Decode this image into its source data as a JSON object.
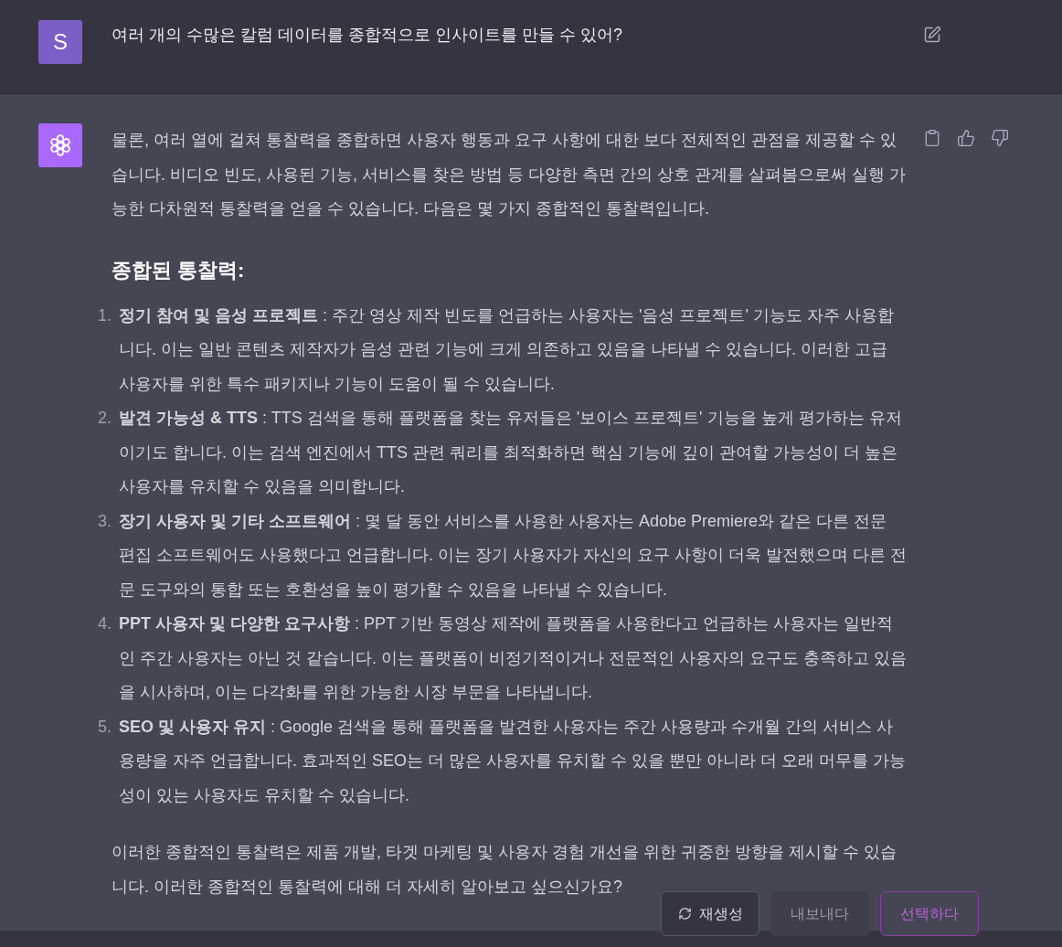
{
  "user_message": {
    "avatar_letter": "S",
    "text": "여러 개의 수많은 칼럼 데이터를 종합적으로 인사이트를 만들 수 있어?"
  },
  "assistant_message": {
    "intro": "물론, 여러 열에 걸쳐 통찰력을 종합하면 사용자 행동과 요구 사항에 대한 보다 전체적인 관점을 제공할 수 있습니다. 비디오 빈도, 사용된 기능, 서비스를 찾은 방법 등 다양한 측면 간의 상호 관계를 살펴봄으로써 실행 가능한 다차원적 통찰력을 얻을 수 있습니다. 다음은 몇 가지 종합적인 통찰력입니다.",
    "heading": "종합된 통찰력:",
    "insights": [
      {
        "number": "1.",
        "text": "**정기 참여 및 음성 프로젝트** : 주간 영상 제작 빈도를 언급하는 사용자는 '음성 프로젝트' 기능도 자주 사용합니다. 이는 일반 콘텐츠 제작자가 음성 관련 기능에 크게 의존하고 있음을 나타낼 수 있습니다. 이러한 고급 사용자를 위한 특수 패키지나 기능이 도움이 될 수 있습니다."
      },
      {
        "number": "2.",
        "text": "**발견 가능성 & TTS** : TTS 검색을 통해 플랫폼을 찾는 유저들은 '보이스 프로젝트' 기능을 높게 평가하는 유저이기도 합니다. 이는 검색 엔진에서 TTS 관련 쿼리를 최적화하면 핵심 기능에 깊이 관여할 가능성이 더 높은 사용자를 유치할 수 있음을 의미합니다."
      },
      {
        "number": "3.",
        "text": "**장기 사용자 및 기타 소프트웨어** : 몇 달 동안 서비스를 사용한 사용자는 Adobe Premiere와 같은 다른 전문 편집 소프트웨어도 사용했다고 언급합니다. 이는 장기 사용자가 자신의 요구 사항이 더욱 발전했으며 다른 전문 도구와의 통합 또는 호환성을 높이 평가할 수 있음을 나타낼 수 있습니다."
      },
      {
        "number": "4.",
        "text": "**PPT 사용자 및 다양한 요구사항** : PPT 기반 동영상 제작에 플랫폼을 사용한다고 언급하는 사용자는 일반적인 주간 사용자는 아닌 것 같습니다. 이는 플랫폼이 비정기적이거나 전문적인 사용자의 요구도 충족하고 있음을 시사하며, 이는 다각화를 위한 가능한 시장 부문을 나타냅니다."
      },
      {
        "number": "5.",
        "text": "**SEO 및 사용자 유지** : Google 검색을 통해 플랫폼을 발견한 사용자는 주간 사용량과 수개월 간의 서비스 사용량을 자주 언급합니다. 효과적인 SEO는 더 많은 사용자를 유치할 수 있을 뿐만 아니라 더 오래 머무를 가능성이 있는 사용자도 유치할 수 있습니다."
      }
    ],
    "closing": "이러한 종합적인 통찰력은 제품 개발, 타겟 마케팅 및 사용자 경험 개선을 위한 귀중한 방향을 제시할 수 있습니다. 이러한 종합적인 통찰력에 대해 더 자세히 알아보고 싶으신가요?"
  },
  "actions": [
    {
      "kind": "regenerate",
      "label": "재생성",
      "disabled": false
    },
    {
      "kind": "export",
      "label": "내보내다",
      "disabled": true
    },
    {
      "kind": "select",
      "label": "선택하다",
      "disabled": false
    }
  ]
}
